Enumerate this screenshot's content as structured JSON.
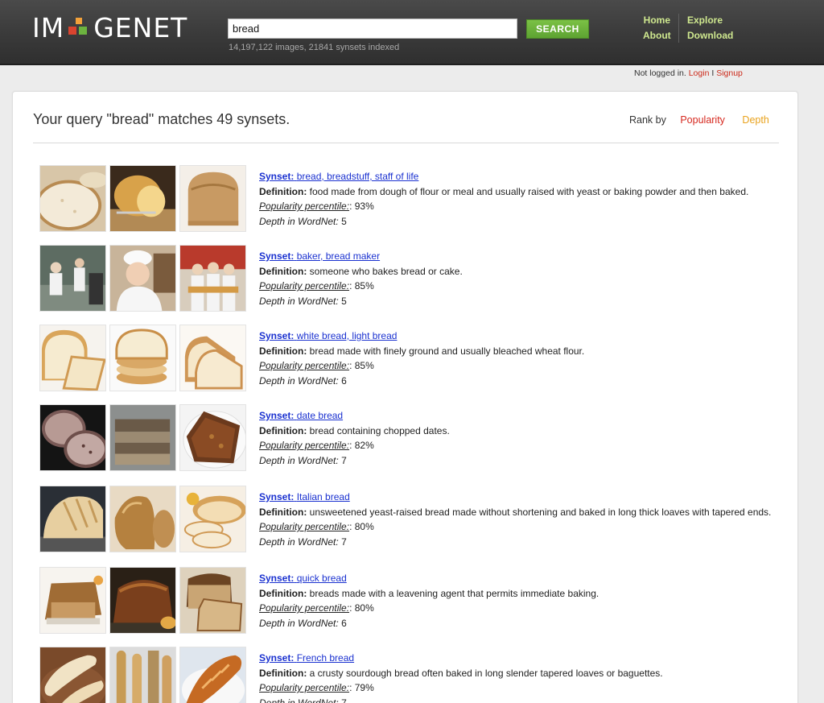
{
  "header": {
    "logo_left": "IM",
    "logo_right": "GENET",
    "search_value": "bread",
    "search_button": "SEARCH",
    "index_stats": "14,197,122 images, 21841 synsets indexed",
    "nav": {
      "home": "Home",
      "about": "About",
      "explore": "Explore",
      "download": "Download"
    },
    "auth": {
      "status": "Not logged in.",
      "login": "Login",
      "separator": "I",
      "signup": "Signup"
    }
  },
  "results": {
    "query_summary": "Your query \"bread\" matches 49 synsets.",
    "rank_by_label": "Rank by",
    "rank_popularity": "Popularity",
    "rank_depth": "Depth",
    "labels": {
      "synset": "Synset:",
      "definition": "Definition:",
      "popularity": "Popularity percentile:",
      "depth": "Depth in WordNet:"
    },
    "items": [
      {
        "name": "bread, breadstuff, staff of life",
        "definition": "food made from dough of flour or meal and usually raised with yeast or baking powder and then baked.",
        "popularity": ": 93%",
        "depth": "5"
      },
      {
        "name": "baker, bread maker",
        "definition": "someone who bakes bread or cake.",
        "popularity": ": 85%",
        "depth": "5"
      },
      {
        "name": "white bread, light bread",
        "definition": "bread made with finely ground and usually bleached wheat flour.",
        "popularity": ": 85%",
        "depth": "6"
      },
      {
        "name": "date bread",
        "definition": "bread containing chopped dates.",
        "popularity": ": 82%",
        "depth": "7"
      },
      {
        "name": "Italian bread",
        "definition": "unsweetened yeast-raised bread made without shortening and baked in long thick loaves with tapered ends.",
        "popularity": ": 80%",
        "depth": "7"
      },
      {
        "name": "quick bread",
        "definition": "breads made with a leavening agent that permits immediate baking.",
        "popularity": ": 80%",
        "depth": "6"
      },
      {
        "name": "French bread",
        "definition": "a crusty sourdough bread often baked in long slender tapered loaves or baguettes.",
        "popularity": ": 79%",
        "depth": "7"
      }
    ]
  },
  "colors": {
    "header_bg": "#3a3a3a",
    "nav_link": "#cfe88f",
    "search_button": "#6cb33f",
    "synset_link": "#1a31d0",
    "popularity_link": "#d6281e",
    "depth_link": "#e9a21c",
    "auth_link": "#cc2a1a"
  }
}
